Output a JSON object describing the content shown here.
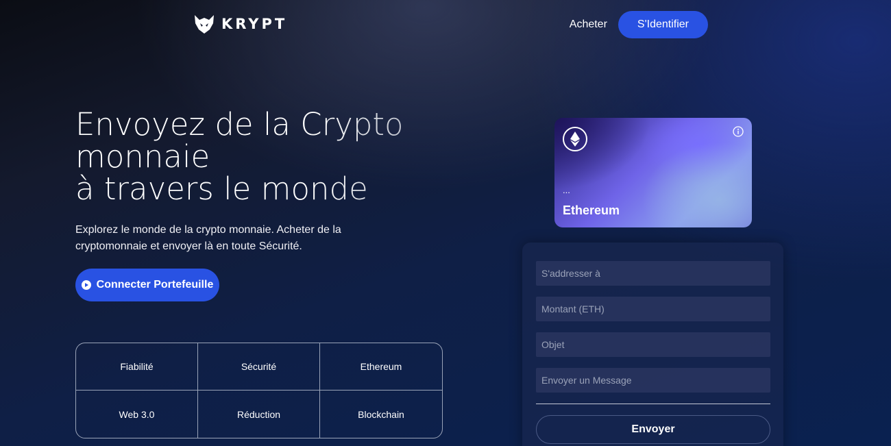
{
  "header": {
    "brand": "KRYPT",
    "nav": {
      "buy_label": "Acheter",
      "login_label": "S'Identifier"
    }
  },
  "hero": {
    "title_line1": "Envoyez de la Crypto",
    "title_line2": "monnaie",
    "title_line3": "à travers le monde",
    "subtitle": "Explorez le monde de la crypto monnaie. Acheter de la cryptomonnaie et envoyer là en toute Sécurité.",
    "connect_label": "Connecter Portefeuille"
  },
  "features": [
    "Fiabilité",
    "Sécurité",
    "Ethereum",
    "Web 3.0",
    "Réduction",
    "Blockchain"
  ],
  "card": {
    "address": "...",
    "network": "Ethereum"
  },
  "form": {
    "address_placeholder": "S'addresser à",
    "amount_placeholder": "Montant (ETH)",
    "keyword_placeholder": "Objet",
    "message_placeholder": "Envoyer un Message",
    "submit_label": "Envoyer"
  },
  "colors": {
    "accent": "#2952e3"
  }
}
